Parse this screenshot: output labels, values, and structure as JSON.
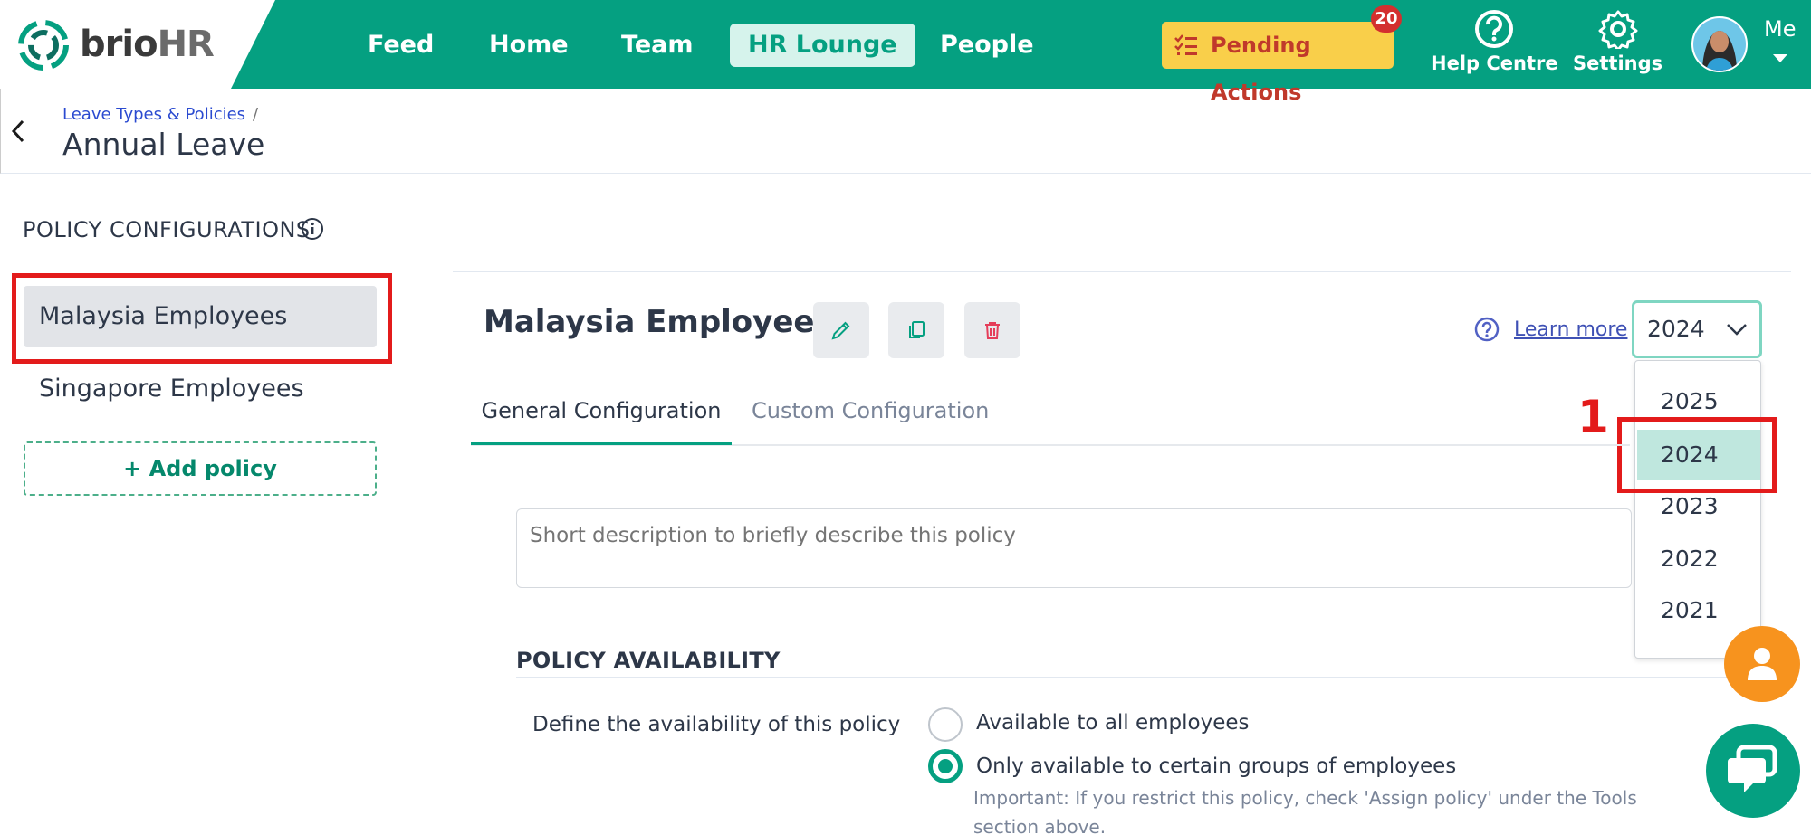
{
  "brand": {
    "name_part1": "brio",
    "name_part2": "HR"
  },
  "nav": {
    "items": [
      {
        "label": "Feed"
      },
      {
        "label": "Home"
      },
      {
        "label": "Team"
      },
      {
        "label": "HR Lounge"
      },
      {
        "label": "People"
      }
    ],
    "active": "HR Lounge",
    "pending_label": "Pending Actions",
    "pending_count": "20",
    "help_label": "Help Centre",
    "settings_label": "Settings",
    "me_label": "Me"
  },
  "header": {
    "breadcrumb": "Leave Types & Policies",
    "breadcrumb_sep": "/",
    "title": "Annual Leave"
  },
  "policy_section": {
    "title": "POLICY CONFIGURATIONS"
  },
  "policies": [
    {
      "label": "Malaysia Employees",
      "selected": true
    },
    {
      "label": "Singapore Employees",
      "selected": false
    }
  ],
  "add_policy_label": "+ Add policy",
  "main": {
    "title": "Malaysia Employees",
    "learn_more": "Learn more",
    "year_selected": "2024",
    "year_options": [
      "2025",
      "2024",
      "2023",
      "2022",
      "2021"
    ],
    "step_label": "1",
    "tabs": [
      {
        "label": "General Configuration",
        "active": true
      },
      {
        "label": "Custom Configuration",
        "active": false
      }
    ],
    "description_placeholder": "Short description to briefly describe this policy",
    "availability": {
      "title": "POLICY AVAILABILITY",
      "label": "Define the availability of this policy",
      "options": [
        {
          "label": "Available to all employees",
          "checked": false
        },
        {
          "label": "Only available to certain groups of employees",
          "checked": true
        }
      ],
      "note": "Important: If you restrict this policy, check 'Assign policy' under the Tools section above."
    }
  },
  "colors": {
    "brand": "#05a081",
    "pending": "#f9cf4a",
    "highlight": "#e31b1b",
    "float_person": "#f7931e"
  }
}
